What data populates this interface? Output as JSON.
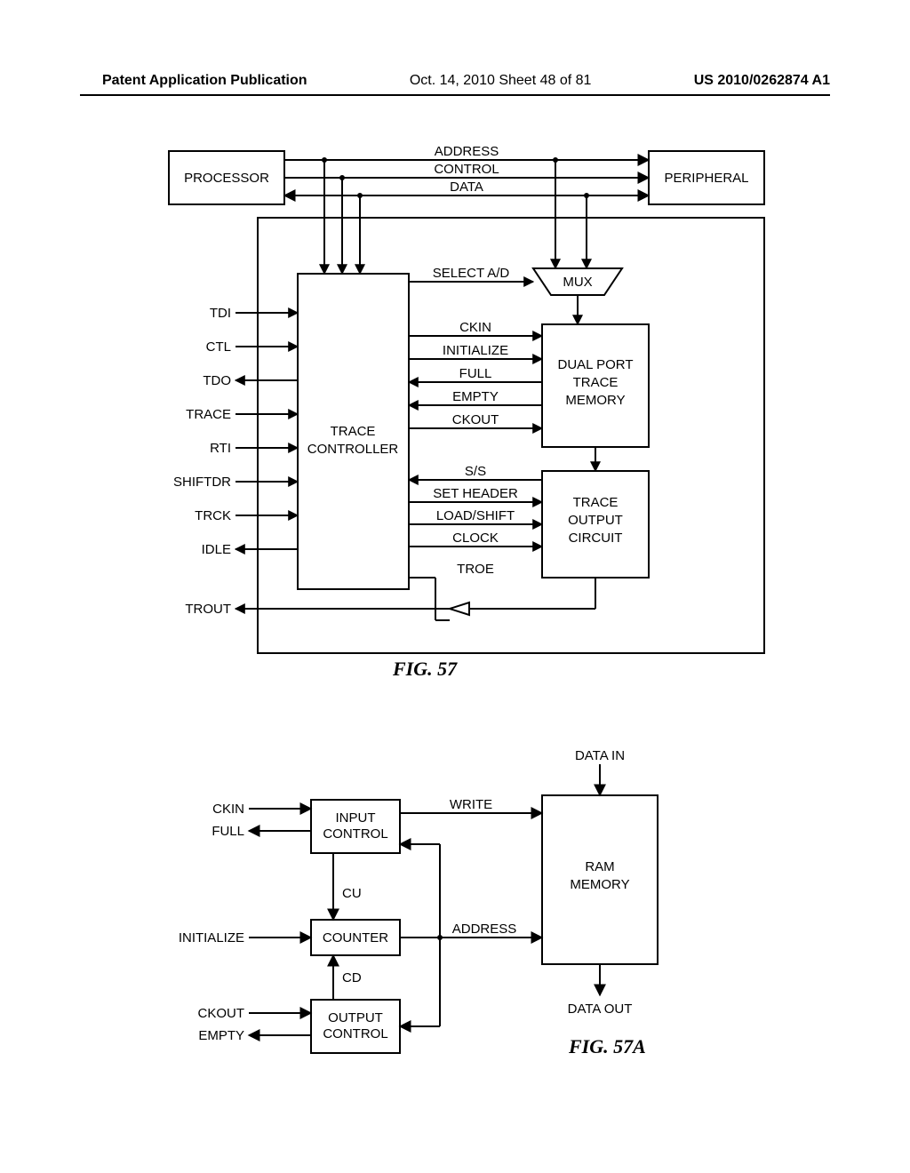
{
  "header": {
    "left": "Patent Application Publication",
    "center": "Oct. 14, 2010  Sheet 48 of 81",
    "right": "US 2010/0262874 A1"
  },
  "fig57": {
    "label": "FIG. 57",
    "blocks": {
      "processor": "PROCESSOR",
      "peripheral": "PERIPHERAL",
      "trace_controller_l1": "TRACE",
      "trace_controller_l2": "CONTROLLER",
      "mux": "MUX",
      "trace_mem_l1": "DUAL PORT",
      "trace_mem_l2": "TRACE",
      "trace_mem_l3": "MEMORY",
      "output_l1": "TRACE",
      "output_l2": "OUTPUT",
      "output_l3": "CIRCUIT"
    },
    "bus": {
      "address": "ADDRESS",
      "control": "CONTROL",
      "data": "DATA"
    },
    "left_ports": {
      "tdi": "TDI",
      "ctl": "CTL",
      "tdo": "TDO",
      "trace": "TRACE",
      "rti": "RTI",
      "shiftdr": "SHIFTDR",
      "trck": "TRCK",
      "idle": "IDLE",
      "trout": "TROUT"
    },
    "mid_signals": {
      "select_ad": "SELECT A/D",
      "ckin": "CKIN",
      "initialize": "INITIALIZE",
      "full": "FULL",
      "empty": "EMPTY",
      "ckout": "CKOUT",
      "ss": "S/S",
      "set_header": "SET HEADER",
      "load_shift": "LOAD/SHIFT",
      "clock": "CLOCK",
      "troe": "TROE"
    }
  },
  "fig57a": {
    "label": "FIG. 57A",
    "blocks": {
      "input_control_l1": "INPUT",
      "input_control_l2": "CONTROL",
      "counter": "COUNTER",
      "output_control_l1": "OUTPUT",
      "output_control_l2": "CONTROL",
      "ram_l1": "RAM",
      "ram_l2": "MEMORY"
    },
    "ports": {
      "ckin": "CKIN",
      "full": "FULL",
      "initialize": "INITIALIZE",
      "ckout": "CKOUT",
      "empty": "EMPTY",
      "data_in": "DATA IN",
      "data_out": "DATA OUT"
    },
    "signals": {
      "write": "WRITE",
      "cu": "CU",
      "address": "ADDRESS",
      "cd": "CD"
    }
  }
}
